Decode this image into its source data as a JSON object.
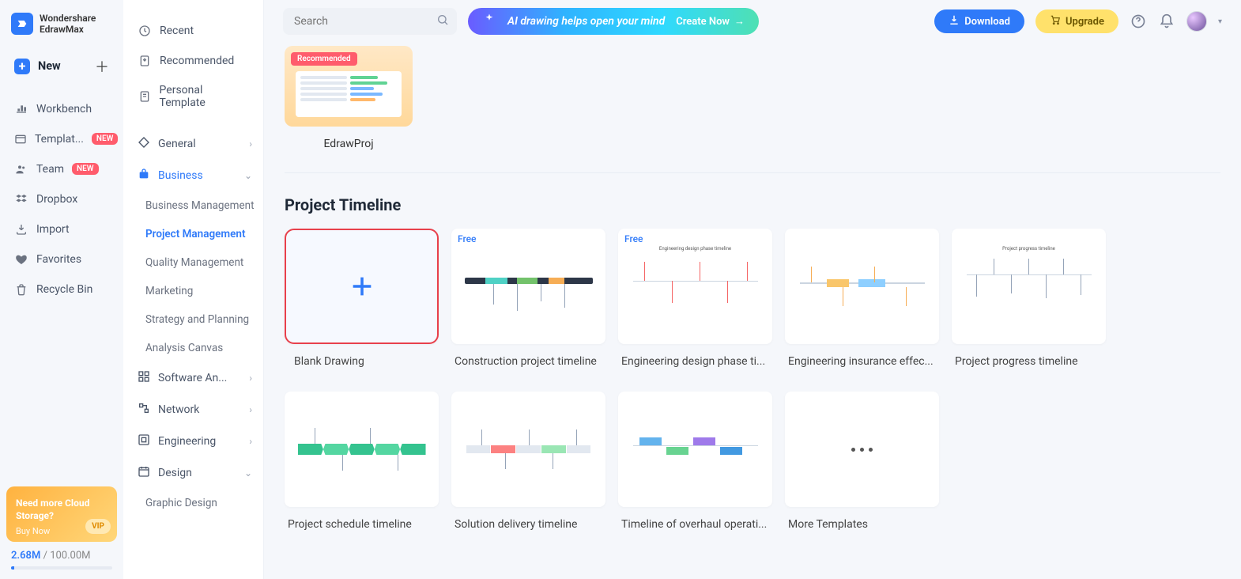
{
  "app": {
    "brand1": "Wondershare",
    "brand2": "EdrawMax"
  },
  "primaryNav": {
    "new": "New",
    "items": [
      {
        "label": "Workbench"
      },
      {
        "label": "Templat...",
        "badge": "NEW"
      },
      {
        "label": "Team",
        "badge": "NEW"
      },
      {
        "label": "Dropbox"
      },
      {
        "label": "Import"
      },
      {
        "label": "Favorites"
      },
      {
        "label": "Recycle Bin"
      }
    ]
  },
  "storagePromo": {
    "line1": "Need more Cloud",
    "line2": "Storage?",
    "buy": "Buy Now",
    "vip": "VIP"
  },
  "storage": {
    "used": "2.68M",
    "sep": " / ",
    "total": "100.00M"
  },
  "secondaryNav": {
    "top": [
      {
        "label": "Recent"
      },
      {
        "label": "Recommended"
      },
      {
        "label": "Personal Template"
      }
    ],
    "categories": [
      {
        "label": "General",
        "expand": "right"
      },
      {
        "label": "Business",
        "expand": "down",
        "active": true,
        "subs": [
          {
            "label": "Business Management"
          },
          {
            "label": "Project Management",
            "active": true
          },
          {
            "label": "Quality Management"
          },
          {
            "label": "Marketing"
          },
          {
            "label": "Strategy and Planning"
          },
          {
            "label": "Analysis Canvas"
          }
        ]
      },
      {
        "label": "Software An...",
        "expand": "right"
      },
      {
        "label": "Network",
        "expand": "right"
      },
      {
        "label": "Engineering",
        "expand": "right"
      },
      {
        "label": "Design",
        "expand": "down"
      },
      {
        "label": "Graphic Design"
      }
    ]
  },
  "topbar": {
    "searchPlaceholder": "Search",
    "aiText": "AI drawing helps open your mind",
    "aiCta": "Create Now",
    "download": "Download",
    "upgrade": "Upgrade"
  },
  "recommended": {
    "badge": "Recommended",
    "card1": "EdrawProj"
  },
  "section": {
    "title": "Project Timeline"
  },
  "tags": {
    "free": "Free"
  },
  "cards": {
    "blank": "Blank Drawing",
    "r1": [
      "Construction project timeline",
      "Engineering design phase ti...",
      "Engineering insurance effec...",
      "Project progress timeline"
    ],
    "r2": [
      "Project schedule timeline",
      "Solution delivery timeline",
      "Timeline of overhaul operati...",
      "More Templates"
    ]
  }
}
